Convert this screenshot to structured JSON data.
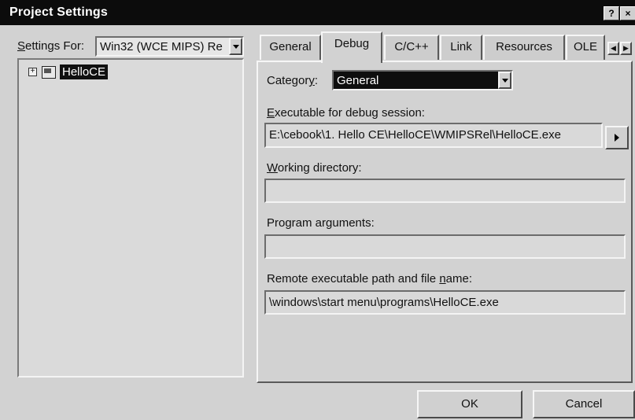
{
  "window": {
    "title": "Project Settings",
    "help_label": "?",
    "close_label": "×"
  },
  "settings_for": {
    "label_prefix": "",
    "label_underlined": "S",
    "label_rest": "ettings For:",
    "value": "Win32 (WCE MIPS) Re"
  },
  "tree": {
    "expander": "+",
    "project_name": "HelloCE"
  },
  "tabs": [
    {
      "label": "General"
    },
    {
      "label": "Debug"
    },
    {
      "label": "C/C++"
    },
    {
      "label": "Link"
    },
    {
      "label": "Resources"
    },
    {
      "label": "OLE"
    }
  ],
  "tab_scroll": {
    "left": "◀",
    "right": "▶"
  },
  "debug": {
    "category_label_pre": "Categor",
    "category_label_u": "y",
    "category_label_post": ":",
    "category_value": "General",
    "executable_label_u": "E",
    "executable_label_rest": "xecutable for debug session:",
    "executable_value": "E:\\cebook\\1. Hello CE\\HelloCE\\WMIPSRel\\HelloCE.exe",
    "working_dir_label_u": "W",
    "working_dir_label_rest": "orking directory:",
    "working_dir_value": "",
    "program_args_label_pre": "Program ar",
    "program_args_label_u": "g",
    "program_args_label_post": "uments:",
    "program_args_value": "",
    "remote_label_pre": "Remote executable path and file ",
    "remote_label_u": "n",
    "remote_label_post": "ame:",
    "remote_value": "\\windows\\start menu\\programs\\HelloCE.exe"
  },
  "buttons": {
    "ok": "OK",
    "cancel": "Cancel"
  }
}
